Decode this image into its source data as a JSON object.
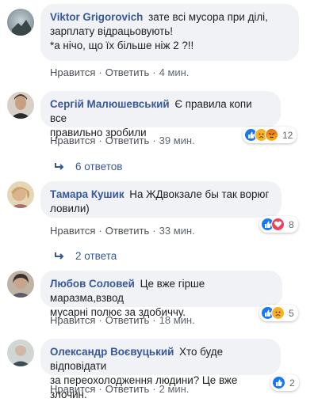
{
  "action_labels": {
    "like": "Нравится",
    "reply": "Ответить",
    "separator": "·"
  },
  "comments": [
    {
      "author": "Viktor Grigorovich",
      "text_lines": [
        "зате всі мусора при ділі,",
        "зарплату відрацьовують!",
        "*а нічо, що їх більше ніж 2 ?!!"
      ],
      "time": "4 мин.",
      "reactions": null,
      "reply_count": null
    },
    {
      "author": "Сергій Малюшевський",
      "text_lines": [
        "Є правила копи все",
        "правильно зробили"
      ],
      "time": "39 мин.",
      "reactions": {
        "icons": [
          "like-icon",
          "sad-icon",
          "angry-icon"
        ],
        "count": "12"
      },
      "reply_count": "6 ответов"
    },
    {
      "author": "Тамара Кушик",
      "text_lines": [
        "На ЖДвокзале бы так ворюг",
        "ловили)"
      ],
      "time": "33 мин.",
      "reactions": {
        "icons": [
          "like-icon",
          "love-icon"
        ],
        "count": "8"
      },
      "reply_count": "2 ответа"
    },
    {
      "author": "Любов Соловей",
      "text_lines": [
        "Це вже гірше маразма,взвод",
        "мусарні полює за здобиччу."
      ],
      "time": "18 мин.",
      "reactions": {
        "icons": [
          "like-icon",
          "sad-icon"
        ],
        "count": "5"
      },
      "reply_count": null
    },
    {
      "author": "Олександр Воєвуцький",
      "text_lines": [
        "Хто буде відповідати",
        "за переохолодження людини? Це вже злочин."
      ],
      "time": "2 мин.",
      "reactions": {
        "icons": [
          "like-icon"
        ],
        "count": "2"
      },
      "reply_count": null
    }
  ],
  "colors": {
    "author": "#385898",
    "bubble": "#f0f2f5",
    "like": "#1877f2",
    "love": "#f33e58",
    "sad": "#f7b125"
  }
}
